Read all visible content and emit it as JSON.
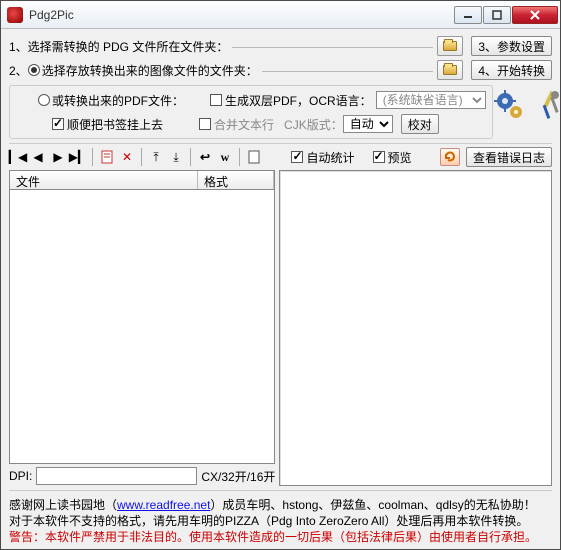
{
  "title": "Pdg2Pic",
  "top": {
    "row1": "1、选择需转换的 PDG 文件所在文件夹：",
    "btn_params": "3、参数设置",
    "row2": "2、",
    "row2_radio": "选择存放转换出来的图像文件的文件夹：",
    "btn_start": "4、开始转换"
  },
  "opts": {
    "alt_radio": "或转换出来的PDF文件：",
    "double_layer": "生成双层PDF，OCR语言：",
    "ocr_lang": "(系统缺省语言)",
    "bookmark": "顺便把书签挂上去",
    "merge": "合并文本行",
    "cjk_label": "CJK版式：",
    "cjk_value": "自动",
    "proof": "校对"
  },
  "midrow": {
    "auto_stat": "自动统计",
    "preview": "预览",
    "err_log": "查看错误日志"
  },
  "table": {
    "col1": "文件",
    "col2": "格式"
  },
  "dpi": {
    "label": "DPI:",
    "suffix": "CX/32开/16开"
  },
  "footer": {
    "line1a": "感谢网上读书园地（",
    "link": "www.readfree.net",
    "line1b": "）成员车明、hstong、伊兹鱼、coolman、qdlsy的无私协助！",
    "line2": "对于本软件不支持的格式，请先用车明的PIZZA（Pdg Into ZeroZero All）处理后再用本软件转换。",
    "warn_label": "警告：",
    "warn_text": "本软件严禁用于非法目的。使用本软件造成的一切后果（包括法律后果）由使用者自行承担。"
  }
}
